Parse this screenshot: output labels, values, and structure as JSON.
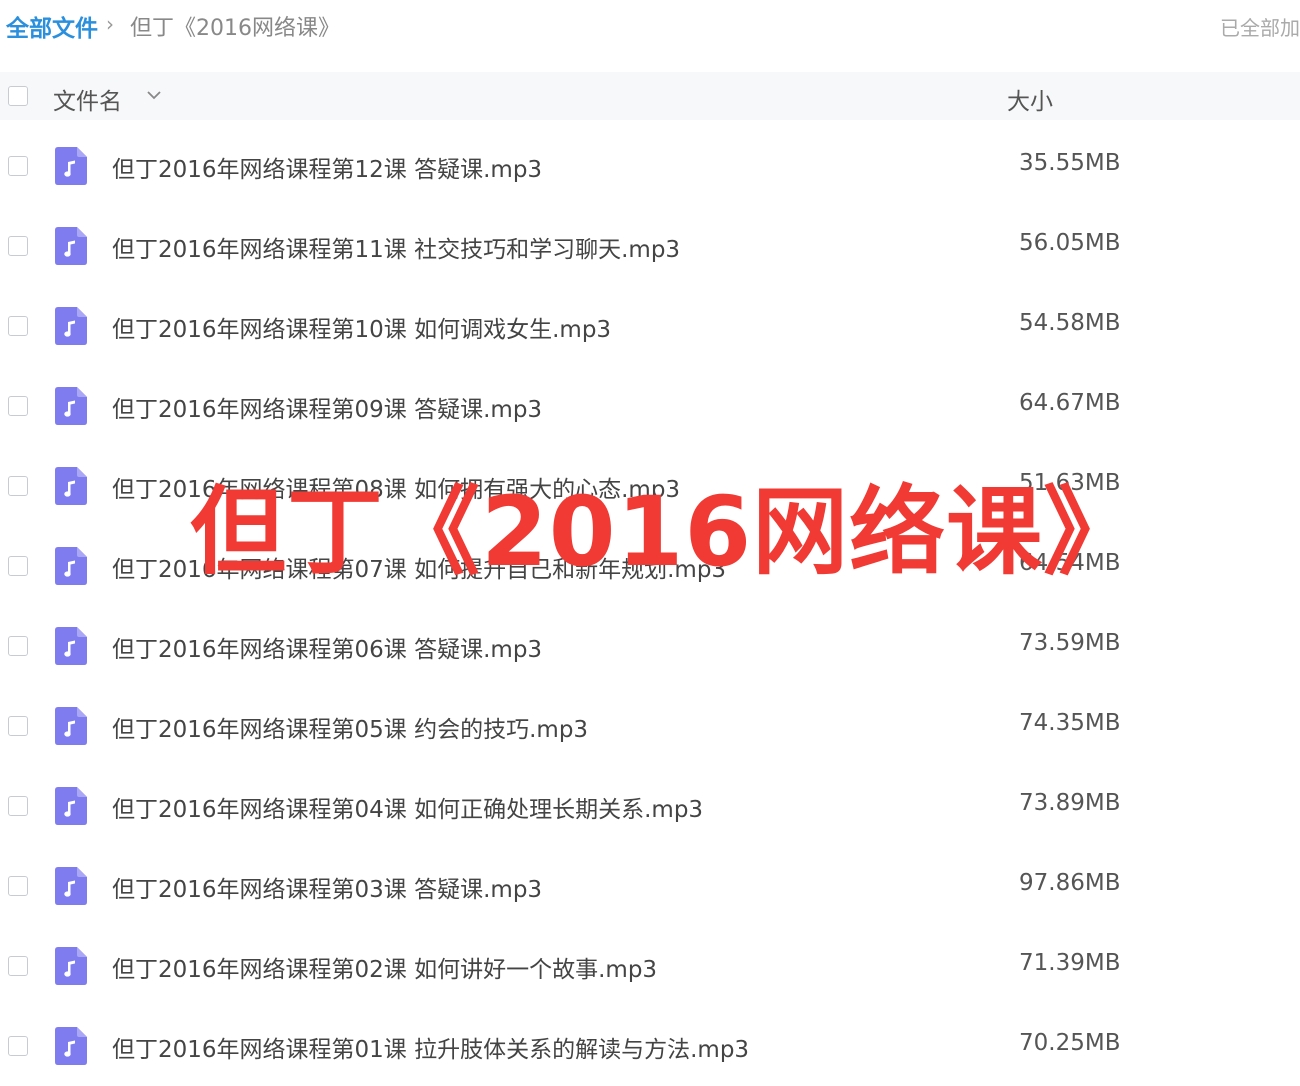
{
  "breadcrumb": {
    "root": "全部文件",
    "separator": "›",
    "current": "但丁《2016网络课》"
  },
  "status": "已全部加",
  "table": {
    "columns": {
      "name": "文件名",
      "size": "大小"
    },
    "rows": [
      {
        "name": "但丁2016年网络课程第12课 答疑课.mp3",
        "size": "35.55MB",
        "icon": "audio-file-icon"
      },
      {
        "name": "但丁2016年网络课程第11课 社交技巧和学习聊天.mp3",
        "size": "56.05MB",
        "icon": "audio-file-icon"
      },
      {
        "name": "但丁2016年网络课程第10课 如何调戏女生.mp3",
        "size": "54.58MB",
        "icon": "audio-file-icon"
      },
      {
        "name": "但丁2016年网络课程第09课 答疑课.mp3",
        "size": "64.67MB",
        "icon": "audio-file-icon"
      },
      {
        "name": "但丁2016年网络课程第08课 如何拥有强大的心态.mp3",
        "size": "51.63MB",
        "icon": "audio-file-icon"
      },
      {
        "name": "但丁2016年网络课程第07课 如何提升自己和新年规划.mp3",
        "size": "64.54MB",
        "icon": "audio-file-icon"
      },
      {
        "name": "但丁2016年网络课程第06课 答疑课.mp3",
        "size": "73.59MB",
        "icon": "audio-file-icon"
      },
      {
        "name": "但丁2016年网络课程第05课 约会的技巧.mp3",
        "size": "74.35MB",
        "icon": "audio-file-icon"
      },
      {
        "name": "但丁2016年网络课程第04课 如何正确处理长期关系.mp3",
        "size": "73.89MB",
        "icon": "audio-file-icon"
      },
      {
        "name": "但丁2016年网络课程第03课 答疑课.mp3",
        "size": "97.86MB",
        "icon": "audio-file-icon"
      },
      {
        "name": "但丁2016年网络课程第02课 如何讲好一个故事.mp3",
        "size": "71.39MB",
        "icon": "audio-file-icon"
      },
      {
        "name": "但丁2016年网络课程第01课 拉升肢体关系的解读与方法.mp3",
        "size": "70.25MB",
        "icon": "audio-file-icon"
      }
    ]
  },
  "watermark": "但丁《2016网络课》",
  "colors": {
    "link": "#2a8fdc",
    "icon_bg": "#7f7cf0",
    "watermark": "#f03a33"
  }
}
